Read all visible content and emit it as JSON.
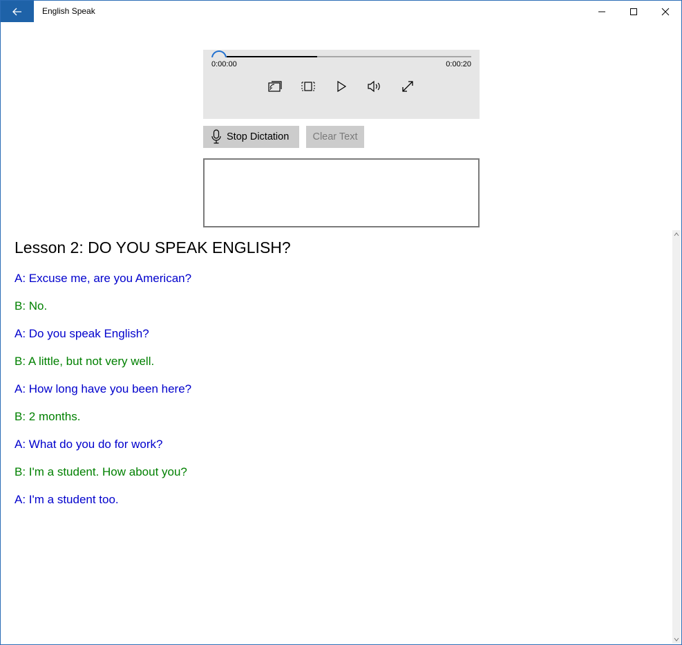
{
  "window": {
    "title": "English Speak",
    "accent_color": "#1e62a8"
  },
  "titlebar": {
    "back_icon": "arrow-left-icon",
    "minimize_icon": "minimize-icon",
    "maximize_icon": "maximize-icon",
    "close_icon": "close-icon"
  },
  "media_player": {
    "current_time": "0:00:00",
    "total_time": "0:00:20",
    "progress": 0.37,
    "controls": [
      "cast-icon",
      "aspect-ratio-icon",
      "play-icon",
      "volume-icon",
      "fullscreen-icon"
    ]
  },
  "buttons": {
    "stop_dictation": "Stop Dictation",
    "clear_text": "Clear Text"
  },
  "dictation_text": "",
  "lesson": {
    "title": "Lesson 2: DO YOU SPEAK ENGLISH?",
    "lines": [
      {
        "text": "A: Excuse me, are you American?",
        "speaker": "A"
      },
      {
        "text": "B: No.",
        "speaker": "B"
      },
      {
        "text": "A: Do you speak English?",
        "speaker": "A"
      },
      {
        "text": "B: A little, but not very well.",
        "speaker": "B"
      },
      {
        "text": "A: How long have you been here?",
        "speaker": "A"
      },
      {
        "text": "B: 2 months.",
        "speaker": "B"
      },
      {
        "text": "A: What do you do for work?",
        "speaker": "A"
      },
      {
        "text": "B: I'm a student. How about you?",
        "speaker": "B"
      },
      {
        "text": "A: I'm a student too.",
        "speaker": "A"
      }
    ],
    "colors": {
      "A": "#0000cc",
      "B": "#008000"
    }
  }
}
